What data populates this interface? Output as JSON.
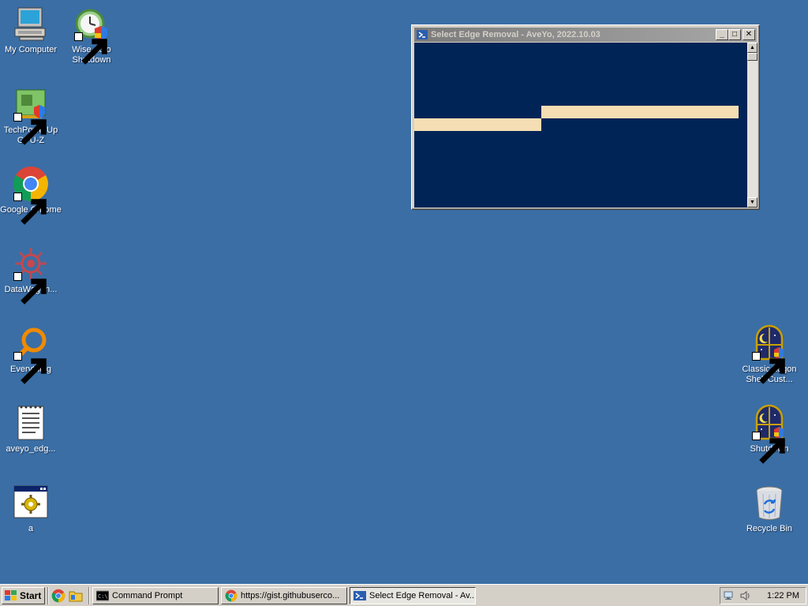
{
  "desktop": {
    "icons_left": [
      {
        "label": "My Computer",
        "icon": "computer-icon"
      },
      {
        "label": "Wise Auto\nShutdown",
        "icon": "shutdown-clock-icon"
      },
      {
        "label": "TechPowerUp\nGPU-Z",
        "icon": "gpu-card-icon"
      },
      {
        "label": "Google Chrome",
        "icon": "chrome-icon"
      },
      {
        "label": "DataWagon...",
        "icon": "gear-burst-icon"
      },
      {
        "label": "Everything",
        "icon": "magnifier-icon"
      },
      {
        "label": "aveyo_edg...",
        "icon": "text-document-icon"
      },
      {
        "label": "a",
        "icon": "script-window-icon"
      }
    ],
    "icons_right": [
      {
        "label": "Classic Logon\nShell Cust...",
        "icon": "moon-window-icon"
      },
      {
        "label": "Shutdown",
        "icon": "moon-window-icon"
      },
      {
        "label": "Recycle Bin",
        "icon": "recycle-bin-icon"
      }
    ]
  },
  "window": {
    "title": "Select Edge Removal - AveYo, 2022.10.03",
    "buttons": {
      "minimize": "_",
      "maximize": "□",
      "close": "✕"
    },
    "console_bg": "#012456",
    "highlight_color": "#f5deb3"
  },
  "taskbar": {
    "start_label": "Start",
    "tasks": [
      {
        "label": "Command Prompt",
        "icon": "cmd-icon"
      },
      {
        "label": "https://gist.githubuserco...",
        "icon": "chrome-icon"
      },
      {
        "label": "Select Edge Removal - Av...",
        "icon": "powershell-icon"
      }
    ],
    "clock": "1:22 PM"
  }
}
